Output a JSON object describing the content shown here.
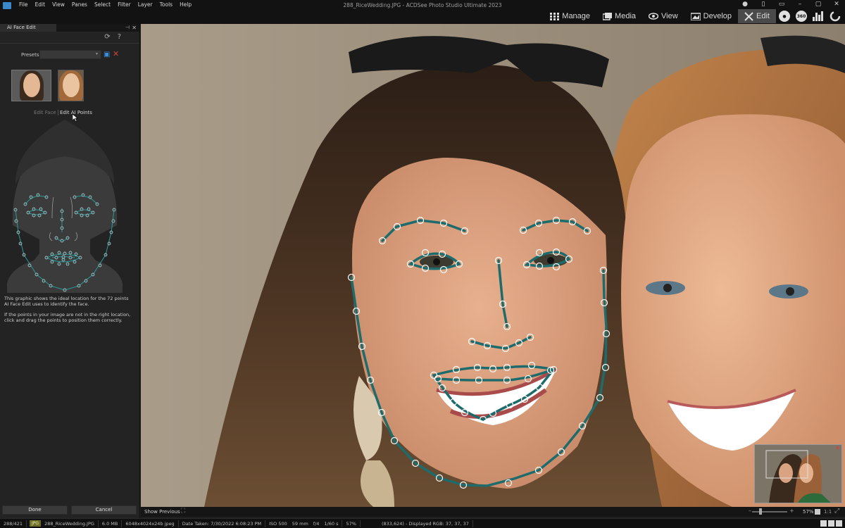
{
  "window": {
    "title": "288_RiceWedding.JPG - ACDSee Photo Studio Ultimate 2023",
    "menu": [
      "File",
      "Edit",
      "View",
      "Panes",
      "Select",
      "Filter",
      "Layer",
      "Tools",
      "Help"
    ],
    "controls": [
      "restore-icon",
      "sidebar-icon",
      "layout-icon",
      "minimize-icon",
      "maximize-icon",
      "close-icon"
    ]
  },
  "modes": {
    "manage": "Manage",
    "media": "Media",
    "view": "View",
    "develop": "Develop",
    "edit": "Edit",
    "active": "Edit",
    "extra_icons": [
      "people-icon",
      "360-icon",
      "histogram-icon",
      "refresh-mode-icon"
    ]
  },
  "panel": {
    "tab": "AI Face Edit",
    "presets_label": "Presets",
    "presets_value": "",
    "edit_face": "Edit Face",
    "edit_ai_points": "Edit AI Points",
    "help_line1": "This graphic shows the ideal location for the 72 points AI Face Edit uses to identify the face.",
    "help_line2": "If the points in your image are not in the right location, click and drag the points to position them correctly.",
    "done": "Done",
    "cancel": "Cancel"
  },
  "viewer": {
    "show_previous": "Show Previous",
    "zoom": "57%",
    "one_to_one": "1:1"
  },
  "status": {
    "index": "288/421",
    "format": "JPG",
    "filename": "288_RiceWedding.JPG",
    "size": "6.0 MB",
    "dimensions": "6048x4024x24b jpeg",
    "date_taken": "Date Taken: 7/30/2022 6:08:23 PM",
    "iso": "ISO 500",
    "focal": "59 mm",
    "aperture": "f/4",
    "shutter": "1/60 s",
    "zoom": "57%",
    "pixel": "(833,624) - Displayed RGB: 37, 37, 37"
  },
  "colors": {
    "accent": "#3a88c9",
    "landmark": "#1f6b6b",
    "point": "#ffffff",
    "active_tab": "#4a4a4a"
  }
}
